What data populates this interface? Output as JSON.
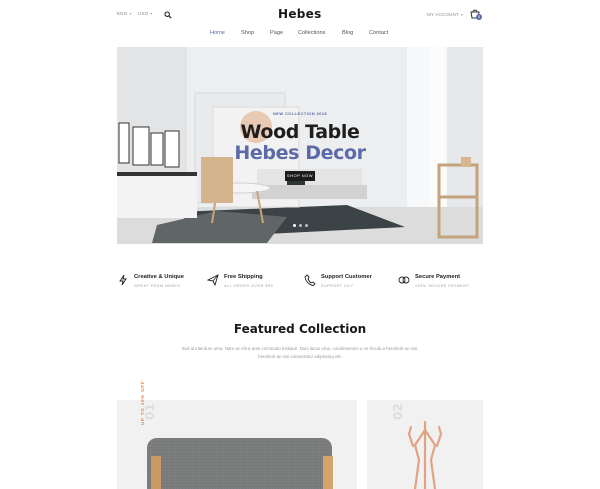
{
  "header": {
    "language": "ENG",
    "currency": "USD",
    "logo": "Hebes",
    "account": "MY ACCOUNT",
    "cart_count": "0"
  },
  "nav": {
    "items": [
      "Home",
      "Shop",
      "Page",
      "Collections",
      "Blog",
      "Contact"
    ],
    "active": "Home"
  },
  "hero": {
    "eyebrow": "NEW COLLECTION 2018",
    "title_line1": "Wood Table",
    "title_line2": "Hebes Decor",
    "button": "SHOP NOW"
  },
  "features": [
    {
      "title": "Creative & Unique",
      "subtitle": "GREAT FROM HEBES",
      "icon": "lightning-icon"
    },
    {
      "title": "Free Shipping",
      "subtitle": "ALL ORDER OVER $99",
      "icon": "paper-plane-icon"
    },
    {
      "title": "Support Customer",
      "subtitle": "SUPPORT 24/7",
      "icon": "phone-icon"
    },
    {
      "title": "Secure Payment",
      "subtitle": "100% SECURE PAYMENT",
      "icon": "rings-icon"
    }
  ],
  "featured": {
    "title": "Featured Collection",
    "description": "Sed id interdum urna. Nam ac elit a ante commodo tristique. Duis lacus urna, condimentum a ve-hicula a hendrerit ac nisi. hendrerit ac nisi consectetur adipiscing elit."
  },
  "cards": [
    {
      "number": "01",
      "tag": "UP TO 40% OFF"
    },
    {
      "number": "02"
    }
  ],
  "colors": {
    "accent": "#5c6aa8",
    "sale": "#e28a4c",
    "dark": "#1c1c1c"
  }
}
